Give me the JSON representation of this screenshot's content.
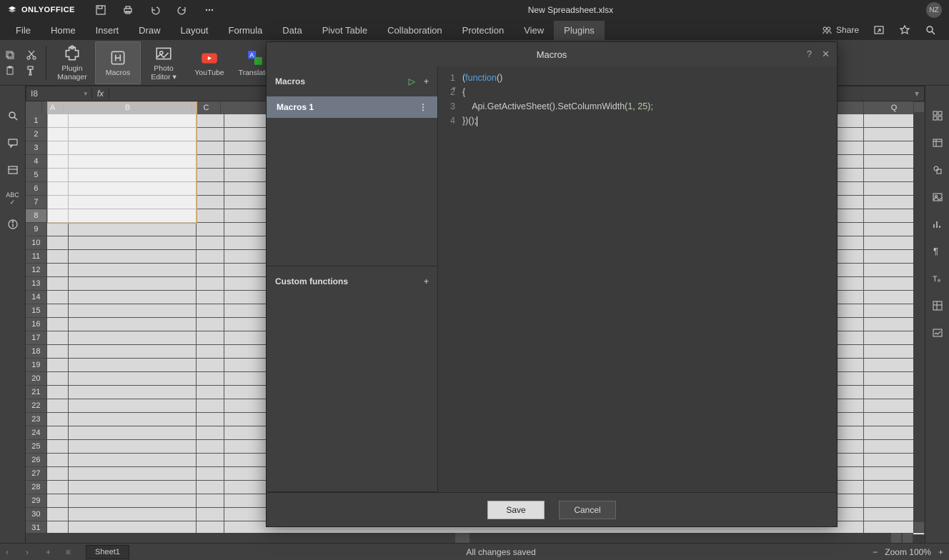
{
  "app": {
    "name": "ONLYOFFICE",
    "doc_title": "New Spreadsheet.xlsx",
    "user_initials": "NZ"
  },
  "menu": {
    "items": [
      "File",
      "Home",
      "Insert",
      "Draw",
      "Layout",
      "Formula",
      "Data",
      "Pivot Table",
      "Collaboration",
      "Protection",
      "View",
      "Plugins"
    ],
    "active_index": 11,
    "share_label": "Share"
  },
  "ribbon": {
    "buttons": [
      {
        "label": "Plugin\nManager",
        "icon": "puzzle"
      },
      {
        "label": "Macros",
        "icon": "macros",
        "active": true
      },
      {
        "label": "Photo\nEditor",
        "icon": "photo",
        "dropdown": true
      },
      {
        "label": "YouTube",
        "icon": "youtube"
      },
      {
        "label": "Translator",
        "icon": "translate"
      }
    ]
  },
  "formula": {
    "cellref": "I8",
    "fx": "fx",
    "value": ""
  },
  "grid": {
    "visible_cols": [
      "A",
      "B",
      "C",
      "Q"
    ],
    "col_widths": {
      "A": 30,
      "B": 180,
      "C": 40,
      "gap": 900,
      "Q": 85
    },
    "visible_rows": 31,
    "selected_row": 8,
    "selection": {
      "top": 0,
      "left": 0,
      "rows": 9,
      "cols": 2
    }
  },
  "modal": {
    "title": "Macros",
    "side": {
      "macros_label": "Macros",
      "macro_items": [
        "Macros 1"
      ],
      "custom_label": "Custom functions"
    },
    "code": {
      "lines": [
        {
          "n": 1,
          "tokens": [
            [
              "(",
              ""
            ],
            [
              "function",
              "kw"
            ],
            [
              "()",
              ""
            ]
          ]
        },
        {
          "n": 2,
          "tokens": [
            [
              "{",
              ""
            ]
          ]
        },
        {
          "n": 3,
          "tokens": [
            [
              "    Api.GetActiveSheet().SetColumnWidth(",
              ""
            ],
            [
              "1",
              "num"
            ],
            [
              ", ",
              ""
            ],
            [
              "25",
              "num"
            ],
            [
              ");",
              ""
            ]
          ]
        },
        {
          "n": 4,
          "tokens": [
            [
              "})();",
              ""
            ]
          ]
        }
      ]
    },
    "buttons": {
      "save": "Save",
      "cancel": "Cancel"
    }
  },
  "status": {
    "sheet": "Sheet1",
    "msg": "All changes saved",
    "zoom": "Zoom 100%"
  }
}
